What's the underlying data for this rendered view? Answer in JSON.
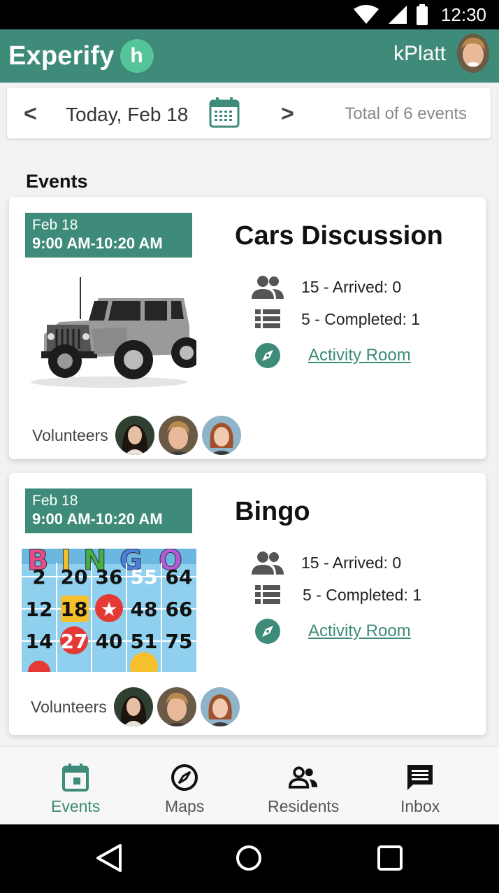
{
  "status_bar": {
    "time": "12:30"
  },
  "app_bar": {
    "brand": "Experify",
    "brand_badge": "h",
    "username": "kPlatt"
  },
  "date_bar": {
    "prev": "<",
    "date": "Today, Feb 18",
    "next": ">",
    "total": "Total of 6 events"
  },
  "section_title": "Events",
  "events": [
    {
      "date": "Feb 18",
      "time": "9:00 AM-10:20 AM",
      "title": "Cars Discussion",
      "image": "jeep-image",
      "arrived": "15 - Arrived: 0",
      "completed": "5 - Completed: 1",
      "location": "Activity Room",
      "volunteers_label": "Volunteers"
    },
    {
      "date": "Feb 18",
      "time": "9:00 AM-10:20 AM",
      "title": "Bingo",
      "image": "bingo-image",
      "arrived": "15 - Arrived: 0",
      "completed": "5 - Completed: 1",
      "location": "Activity Room",
      "volunteers_label": "Volunteers",
      "bingo_rows": [
        [
          "2",
          "20",
          "36",
          "55",
          "64"
        ],
        [
          "12",
          "18",
          "★",
          "48",
          "66"
        ],
        [
          "14",
          "27",
          "40",
          "51",
          "75"
        ]
      ]
    }
  ],
  "bottom_nav": [
    {
      "label": "Events",
      "icon": "calendar-icon",
      "active": true
    },
    {
      "label": "Maps",
      "icon": "compass-icon",
      "active": false
    },
    {
      "label": "Residents",
      "icon": "people-icon",
      "active": false
    },
    {
      "label": "Inbox",
      "icon": "message-icon",
      "active": false
    }
  ],
  "colors": {
    "primary": "#3d8b78",
    "badge": "#56c49a",
    "text": "#222222"
  }
}
